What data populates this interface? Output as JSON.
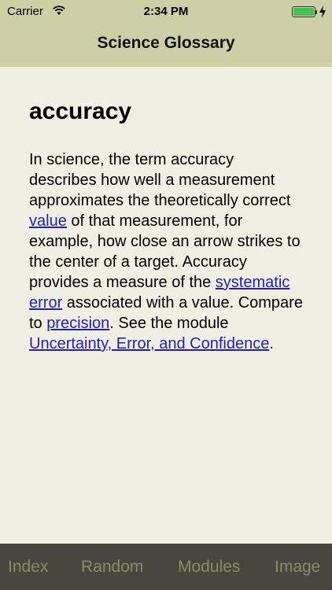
{
  "status_bar": {
    "carrier": "Carrier",
    "time": "2:34 PM",
    "battery_level": 1.0,
    "battery_color": "#3fc24f"
  },
  "nav_bar": {
    "title": "Science Glossary",
    "background_color": "#cfcfa7"
  },
  "entry": {
    "term": "accuracy",
    "definition": [
      {
        "type": "text",
        "text": "In science, the term accuracy describes how well a measurement approximates the theoretically correct "
      },
      {
        "type": "link",
        "text": "value"
      },
      {
        "type": "text",
        "text": " of that measurement, for example, how close an arrow strikes to the center of a target. Accuracy provides a measure of the "
      },
      {
        "type": "link",
        "text": "systematic error"
      },
      {
        "type": "text",
        "text": " associated with a value. Compare to "
      },
      {
        "type": "link",
        "text": "precision"
      },
      {
        "type": "text",
        "text": ". See the module "
      },
      {
        "type": "link",
        "text": "Uncertainty, Error, and Confidence"
      },
      {
        "type": "text",
        "text": "."
      }
    ],
    "link_color": "#1f1fbf"
  },
  "tab_bar": {
    "tabs": [
      {
        "label": "Index"
      },
      {
        "label": "Random"
      },
      {
        "label": "Modules"
      },
      {
        "label": "Image"
      }
    ],
    "background_color": "#474740"
  }
}
